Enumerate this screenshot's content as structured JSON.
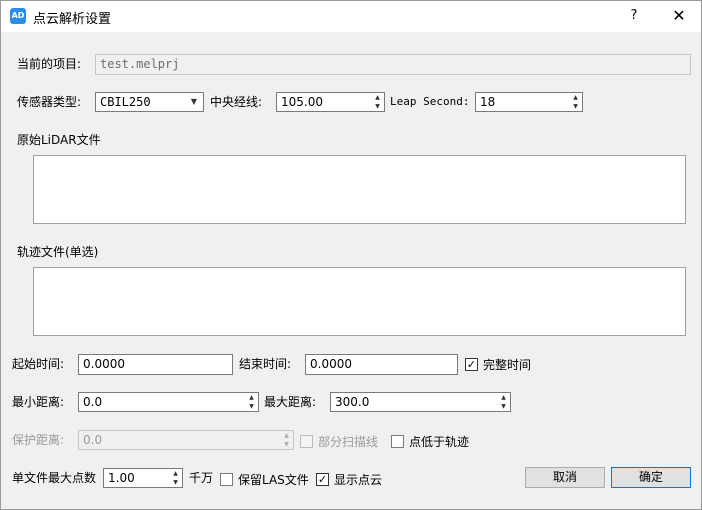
{
  "window": {
    "app_icon_text": "AD",
    "title": "点云解析设置",
    "help_label": "?",
    "close_label": "✕"
  },
  "project": {
    "label": "当前的项目:",
    "value": "test.melprj"
  },
  "sensor": {
    "label": "传感器类型:",
    "value": "CBIL250",
    "central_meridian_label": "中央经线:",
    "central_meridian_value": "105.00",
    "leap_second_label": "Leap Second:",
    "leap_second_value": "18"
  },
  "lidar": {
    "label": "原始LiDAR文件"
  },
  "trajectory": {
    "label": "轨迹文件(单选)"
  },
  "time": {
    "start_label": "起始时间:",
    "start_value": "0.0000",
    "end_label": "结束时间:",
    "end_value": "0.0000",
    "full_time_label": "完整时间",
    "full_time_checked": true
  },
  "distance": {
    "min_label": "最小距离:",
    "min_value": "0.0",
    "max_label": "最大距离:",
    "max_value": "300.0"
  },
  "protection": {
    "label": "保护距离:",
    "value": "0.0",
    "partial_scan_label": "部分扫描线",
    "below_track_label": "点低于轨迹"
  },
  "output": {
    "max_points_label": "单文件最大点数",
    "max_points_value": "1.00",
    "unit_label": "千万",
    "keep_las_label": "保留LAS文件",
    "keep_las_checked": false,
    "show_cloud_label": "显示点云",
    "show_cloud_checked": true
  },
  "buttons": {
    "cancel_label": "取消",
    "ok_label": "确定"
  },
  "icons": {
    "checkmark": "✓",
    "spin_up": "▲",
    "spin_down": "▼",
    "dropdown_arrow": "▼"
  }
}
